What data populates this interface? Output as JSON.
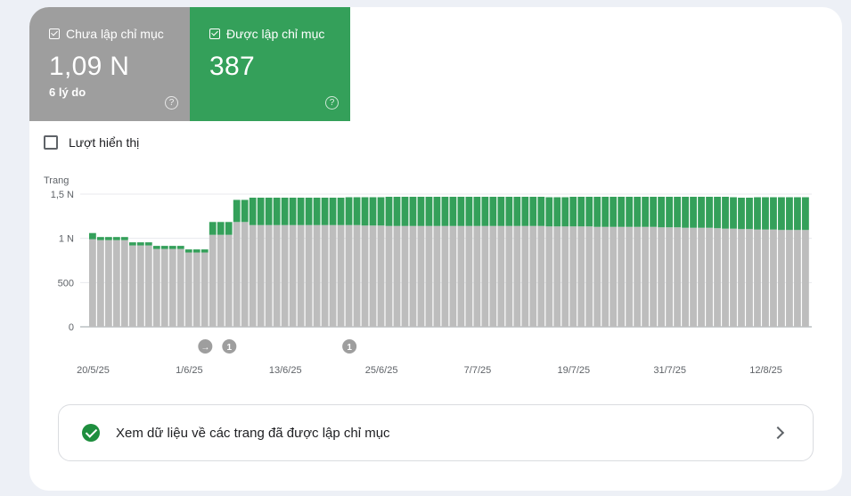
{
  "tiles": [
    {
      "label": "Chưa lập chỉ mục",
      "value": "1,09 N",
      "sub": "6 lý do",
      "help": "?"
    },
    {
      "label": "Được lập chỉ mục",
      "value": "387",
      "help": "?"
    }
  ],
  "impressions_label": "Lượt hiển thị",
  "link_label": "Xem dữ liệu về các trang đã được lập chỉ mục",
  "colors": {
    "not_indexed": "#bdbdbd",
    "indexed": "#34a05a",
    "tile_grey": "#9e9e9e"
  },
  "icons": [
    "checkbox-checked-icon",
    "help-icon",
    "check-circle-icon",
    "chevron-right-icon",
    "arrow-right-icon"
  ],
  "chart_data": {
    "type": "bar",
    "stacked": true,
    "ylabel": "Trang",
    "ylim": [
      0,
      1500
    ],
    "yticks": [
      {
        "v": 0,
        "label": "0"
      },
      {
        "v": 500,
        "label": "500"
      },
      {
        "v": 1000,
        "label": "1 N"
      },
      {
        "v": 1500,
        "label": "1,5 N"
      }
    ],
    "xticks": [
      {
        "i": 0,
        "label": "20/5/25"
      },
      {
        "i": 12,
        "label": "1/6/25"
      },
      {
        "i": 24,
        "label": "13/6/25"
      },
      {
        "i": 36,
        "label": "25/6/25"
      },
      {
        "i": 48,
        "label": "7/7/25"
      },
      {
        "i": 60,
        "label": "19/7/25"
      },
      {
        "i": 72,
        "label": "31/7/25"
      },
      {
        "i": 84,
        "label": "12/8/25"
      }
    ],
    "annotations": [
      {
        "i": 14,
        "label": "→"
      },
      {
        "i": 17,
        "label": "1"
      },
      {
        "i": 32,
        "label": "1"
      }
    ],
    "series": [
      {
        "name": "Chưa lập chỉ mục",
        "values": [
          990,
          980,
          980,
          980,
          980,
          920,
          920,
          920,
          880,
          880,
          880,
          880,
          840,
          840,
          840,
          1040,
          1040,
          1040,
          1185,
          1185,
          1150,
          1150,
          1150,
          1150,
          1150,
          1150,
          1150,
          1150,
          1150,
          1150,
          1150,
          1150,
          1150,
          1150,
          1145,
          1145,
          1145,
          1140,
          1140,
          1140,
          1140,
          1140,
          1140,
          1140,
          1140,
          1140,
          1140,
          1140,
          1140,
          1140,
          1140,
          1140,
          1140,
          1140,
          1140,
          1140,
          1140,
          1135,
          1135,
          1135,
          1135,
          1135,
          1135,
          1130,
          1130,
          1130,
          1130,
          1130,
          1130,
          1130,
          1130,
          1125,
          1125,
          1125,
          1120,
          1120,
          1120,
          1120,
          1115,
          1110,
          1110,
          1105,
          1105,
          1100,
          1100,
          1100,
          1095,
          1095,
          1095,
          1095
        ]
      },
      {
        "name": "Được lập chỉ mục",
        "values": [
          70,
          35,
          35,
          35,
          35,
          35,
          35,
          35,
          35,
          35,
          35,
          35,
          35,
          35,
          35,
          145,
          145,
          145,
          250,
          250,
          310,
          310,
          310,
          310,
          310,
          310,
          310,
          310,
          310,
          310,
          310,
          310,
          315,
          315,
          320,
          320,
          320,
          330,
          330,
          330,
          330,
          330,
          330,
          330,
          330,
          330,
          330,
          330,
          330,
          330,
          330,
          330,
          330,
          330,
          330,
          330,
          330,
          330,
          330,
          330,
          335,
          335,
          335,
          340,
          340,
          340,
          340,
          340,
          340,
          340,
          340,
          345,
          345,
          345,
          350,
          350,
          350,
          350,
          355,
          360,
          355,
          355,
          355,
          365,
          365,
          365,
          370,
          370,
          370,
          370
        ]
      }
    ]
  }
}
